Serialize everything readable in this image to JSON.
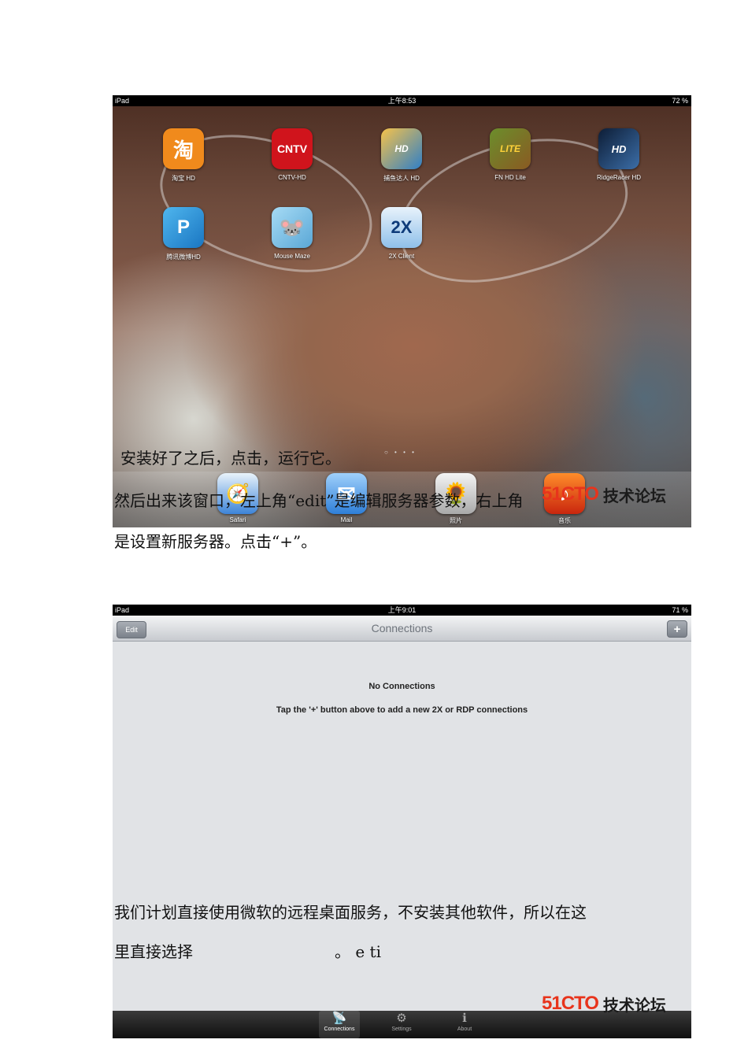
{
  "shot1": {
    "status": {
      "device": "iPad",
      "time": "上午8:53",
      "battery": "72 %"
    },
    "apps": [
      {
        "label": "淘宝 HD",
        "glyph": "淘",
        "color": "#f08a1c"
      },
      {
        "label": "CNTV-HD",
        "glyph": "CNTV",
        "color": "#d0141c"
      },
      {
        "label": "捕鱼达人 HD",
        "glyph": "HD",
        "color": "#f0a830"
      },
      {
        "label": "FN HD Lite",
        "glyph": "LITE",
        "color": "#7a5a2a"
      },
      {
        "label": "RidgeRacer HD",
        "glyph": "HD",
        "color": "#1d3f6a"
      },
      {
        "label": "腾讯微博HD",
        "glyph": "P",
        "color": "#2a8fd6"
      },
      {
        "label": "Mouse Maze",
        "glyph": "🐭",
        "color": "#7cc2e8"
      },
      {
        "label": "2X Client",
        "glyph": "2X",
        "color": "#4a9ad8"
      }
    ],
    "dock": [
      {
        "label": "Safari",
        "glyph": "🧭",
        "color": "#3d84d8"
      },
      {
        "label": "Mail",
        "glyph": "✉",
        "color": "#4f96e6"
      },
      {
        "label": "照片",
        "glyph": "🌻",
        "color": "#c9c9c9"
      },
      {
        "label": "音乐",
        "glyph": "♪",
        "color": "#e0521c"
      }
    ],
    "page_dots": "○ • • •"
  },
  "shot2": {
    "status": {
      "device": "iPad",
      "time": "上午9:01",
      "battery": "71 %"
    },
    "nav": {
      "edit": "Edit",
      "title": "Connections",
      "add": "+"
    },
    "empty_title": "No Connections",
    "empty_sub": "Tap the '+' button above to add a new 2X or RDP connections",
    "tabs": [
      {
        "label": "Connections",
        "glyph": "📡"
      },
      {
        "label": "Settings",
        "glyph": "⚙"
      },
      {
        "label": "About",
        "glyph": "ℹ"
      }
    ]
  },
  "watermark": {
    "brand": "51CTO",
    "text": "技术论坛"
  },
  "text": {
    "line1": "安装好了之后，点击，运行它。",
    "line2": "然后出来该窗口，左上角“edit”是编辑服务器参数，右上角",
    "line3": "是设置新服务器。点击“+”。",
    "line4": "我们计划直接使用微软的远程桌面服务，不安装其他软件，所以在这",
    "line5": "里直接选择",
    "line6": "。 e  ti"
  }
}
